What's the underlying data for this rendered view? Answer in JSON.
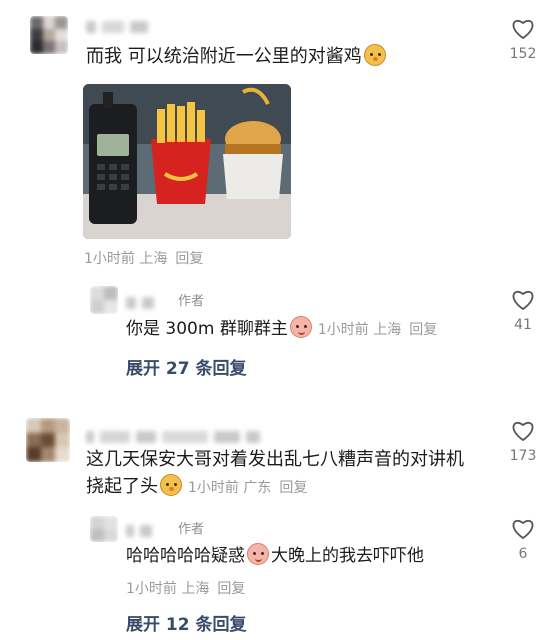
{
  "comments": [
    {
      "text": "而我 可以统治附近一公里的对酱鸡",
      "emoji": "chick-emoji",
      "likes": "152",
      "meta": {
        "time": "1小时前",
        "location": "上海",
        "reply": "回复"
      },
      "replies": [
        {
          "author_tag": "作者",
          "text": "你是 300m 群聊群主",
          "emoji": "peach-emoji",
          "meta": {
            "time": "1小时前",
            "location": "上海",
            "reply": "回复"
          },
          "likes": "41"
        }
      ],
      "expand": "展开 27 条回复"
    },
    {
      "text_line1": "这几天保安大哥对着发出乱七八糟声音的对讲机",
      "text_line2": "挠起了头",
      "emoji": "chick-emoji",
      "likes": "173",
      "meta": {
        "time": "1小时前",
        "location": "广东",
        "reply": "回复"
      },
      "replies": [
        {
          "author_tag": "作者",
          "text_a": "哈哈哈哈哈疑惑",
          "emoji": "peach-emoji",
          "text_b": "大晚上的我去吓吓他",
          "meta": {
            "time": "1小时前",
            "location": "上海",
            "reply": "回复"
          },
          "likes": "6"
        }
      ],
      "expand": "展开 12 条回复"
    }
  ],
  "icons": {
    "like": "heart-outline-icon"
  },
  "colors": {
    "meta": "#9a9a9a",
    "expand": "#3a4a6b",
    "text": "#1c1c1c"
  }
}
